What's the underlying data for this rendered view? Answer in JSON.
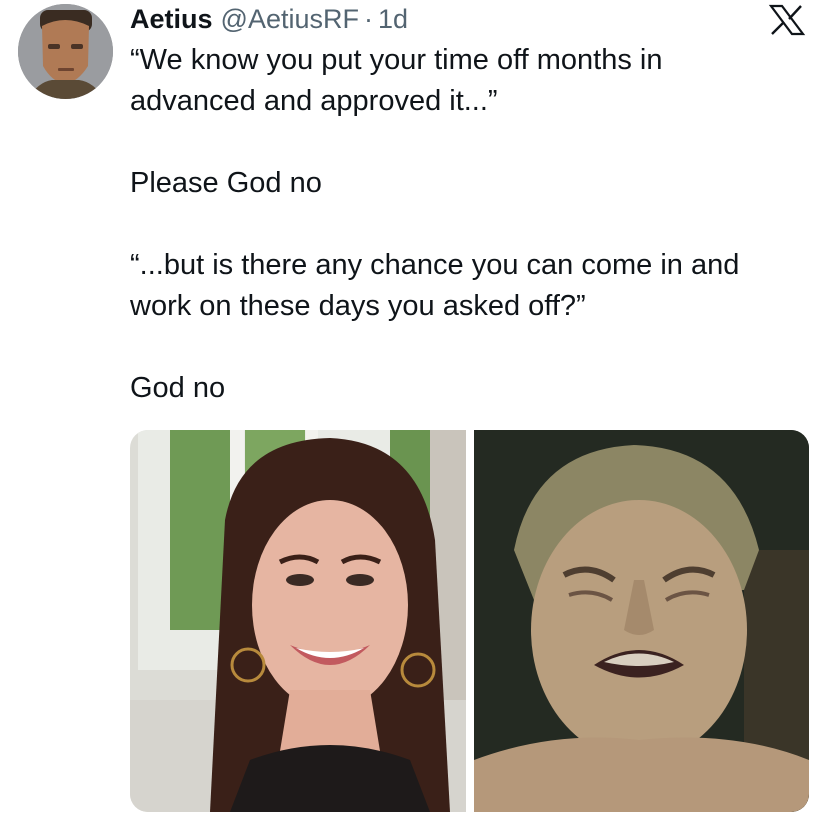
{
  "tweet": {
    "author_name": "Aetius",
    "author_handle": "@AetiusRF",
    "separator": "·",
    "timestamp": "1d",
    "text": "“We know you put your time off months in\nadvanced and approved it...”\n\nPlease God no\n\n“...but is there any chance you can come in and\nwork on these days you asked off?”\n\nGod no"
  },
  "icons": {
    "platform": "x-logo-icon",
    "avatar": "avatar-icon"
  },
  "media": {
    "count": 2
  },
  "colors": {
    "text": "#0f1419",
    "secondary_text": "#536471",
    "background": "#ffffff"
  }
}
